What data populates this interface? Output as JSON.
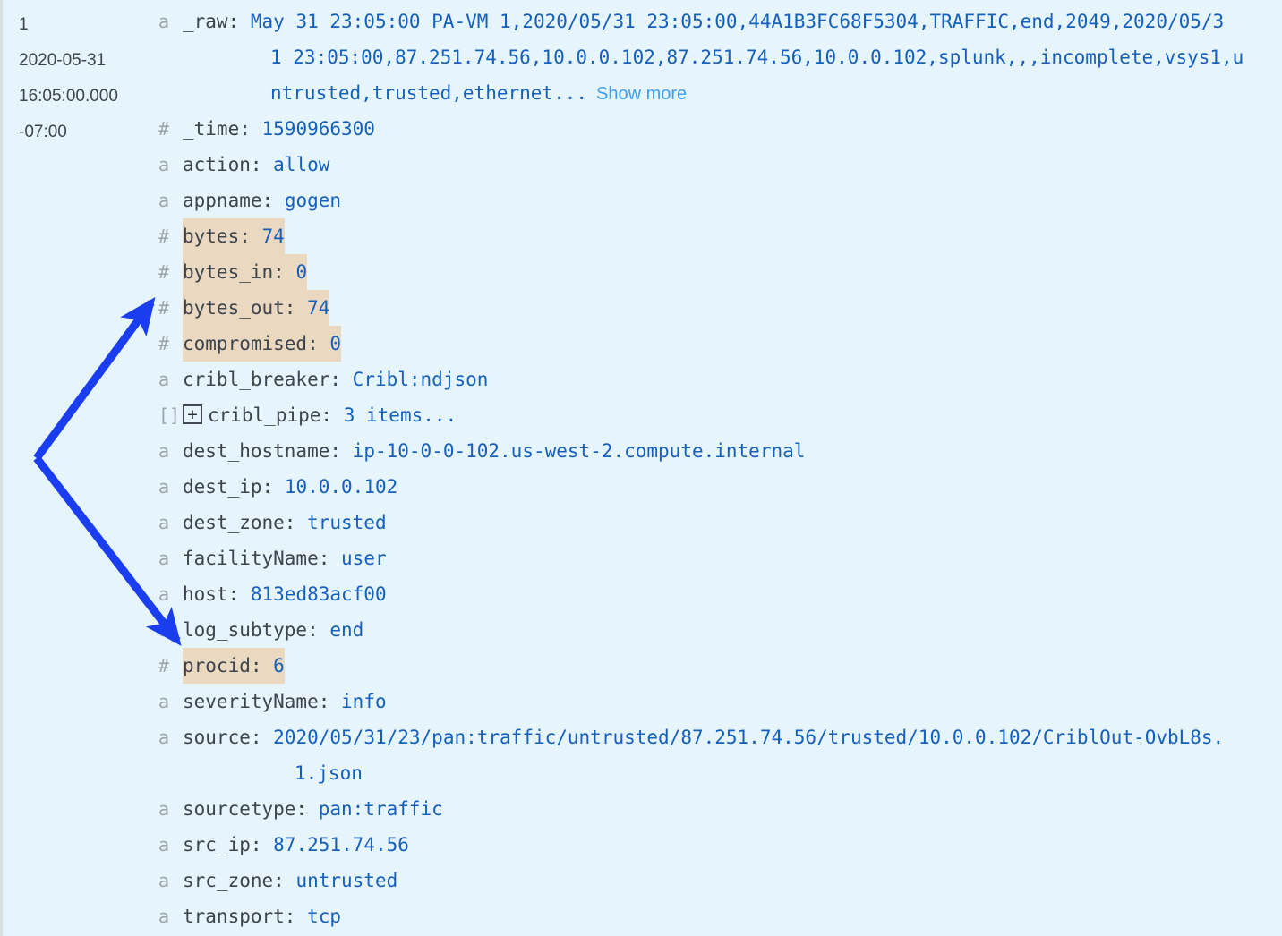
{
  "event": {
    "row_number": "1",
    "timestamp_lines": [
      "2020-05-31",
      "16:05:00.000",
      "-07:00"
    ],
    "show_more_label": "Show more",
    "expander_glyph": "+",
    "type_glyph_string": "a",
    "type_glyph_number": "#",
    "type_glyph_array": "[]"
  },
  "colors": {
    "background": "#e6f4fc",
    "highlight": "#ead9c0",
    "field_name": "#3c444d",
    "field_value": "#1560bd",
    "link": "#3a9ff5",
    "arrow": "#1a3df0",
    "type_glyph": "#9aa3ab"
  },
  "raw": {
    "type": "a",
    "name": "_raw:",
    "line1": "May 31 23:05:00 PA-VM 1,2020/05/31 23:05:00,44A1B3FC68F5304,TRAFFIC,end,2049,2020/05/3",
    "line2": "1 23:05:00,87.251.74.56,10.0.0.102,87.251.74.56,10.0.0.102,splunk,,,incomplete,vsys1,u",
    "line3": "ntrusted,trusted,ethernet..."
  },
  "fields": [
    {
      "type": "#",
      "name": "_time:",
      "value": "1590966300",
      "highlight": false
    },
    {
      "type": "a",
      "name": "action:",
      "value": "allow",
      "highlight": false
    },
    {
      "type": "a",
      "name": "appname:",
      "value": "gogen",
      "highlight": false
    },
    {
      "type": "#",
      "name": "bytes:",
      "value": "74",
      "highlight": true
    },
    {
      "type": "#",
      "name": "bytes_in:",
      "value": "0",
      "highlight": true
    },
    {
      "type": "#",
      "name": "bytes_out:",
      "value": "74",
      "highlight": true
    },
    {
      "type": "#",
      "name": "compromised:",
      "value": "0",
      "highlight": true
    },
    {
      "type": "a",
      "name": "cribl_breaker:",
      "value": "Cribl:ndjson",
      "highlight": false
    },
    {
      "type": "[]",
      "name": "cribl_pipe:",
      "value": "3 items...",
      "highlight": false,
      "expandable": true
    },
    {
      "type": "a",
      "name": "dest_hostname:",
      "value": "ip-10-0-0-102.us-west-2.compute.internal",
      "highlight": false
    },
    {
      "type": "a",
      "name": "dest_ip:",
      "value": "10.0.0.102",
      "highlight": false
    },
    {
      "type": "a",
      "name": "dest_zone:",
      "value": "trusted",
      "highlight": false
    },
    {
      "type": "a",
      "name": "facilityName:",
      "value": "user",
      "highlight": false
    },
    {
      "type": "a",
      "name": "host:",
      "value": "813ed83acf00",
      "highlight": false
    },
    {
      "type": "a",
      "name": "log_subtype:",
      "value": "end",
      "highlight": false
    },
    {
      "type": "#",
      "name": "procid:",
      "value": "6",
      "highlight": true
    },
    {
      "type": "a",
      "name": "severityName:",
      "value": "info",
      "highlight": false
    },
    {
      "type": "a",
      "name": "sourcetype:",
      "value": "pan:traffic",
      "highlight": false
    },
    {
      "type": "a",
      "name": "src_ip:",
      "value": "87.251.74.56",
      "highlight": false
    },
    {
      "type": "a",
      "name": "src_zone:",
      "value": "untrusted",
      "highlight": false
    },
    {
      "type": "a",
      "name": "transport:",
      "value": "tcp",
      "highlight": false
    }
  ],
  "source_field": {
    "type": "a",
    "name": "source:",
    "value_line1": "2020/05/31/23/pan:traffic/untrusted/87.251.74.56/trusted/10.0.0.102/CriblOut-OvbL8s.",
    "value_line2": "1.json"
  }
}
